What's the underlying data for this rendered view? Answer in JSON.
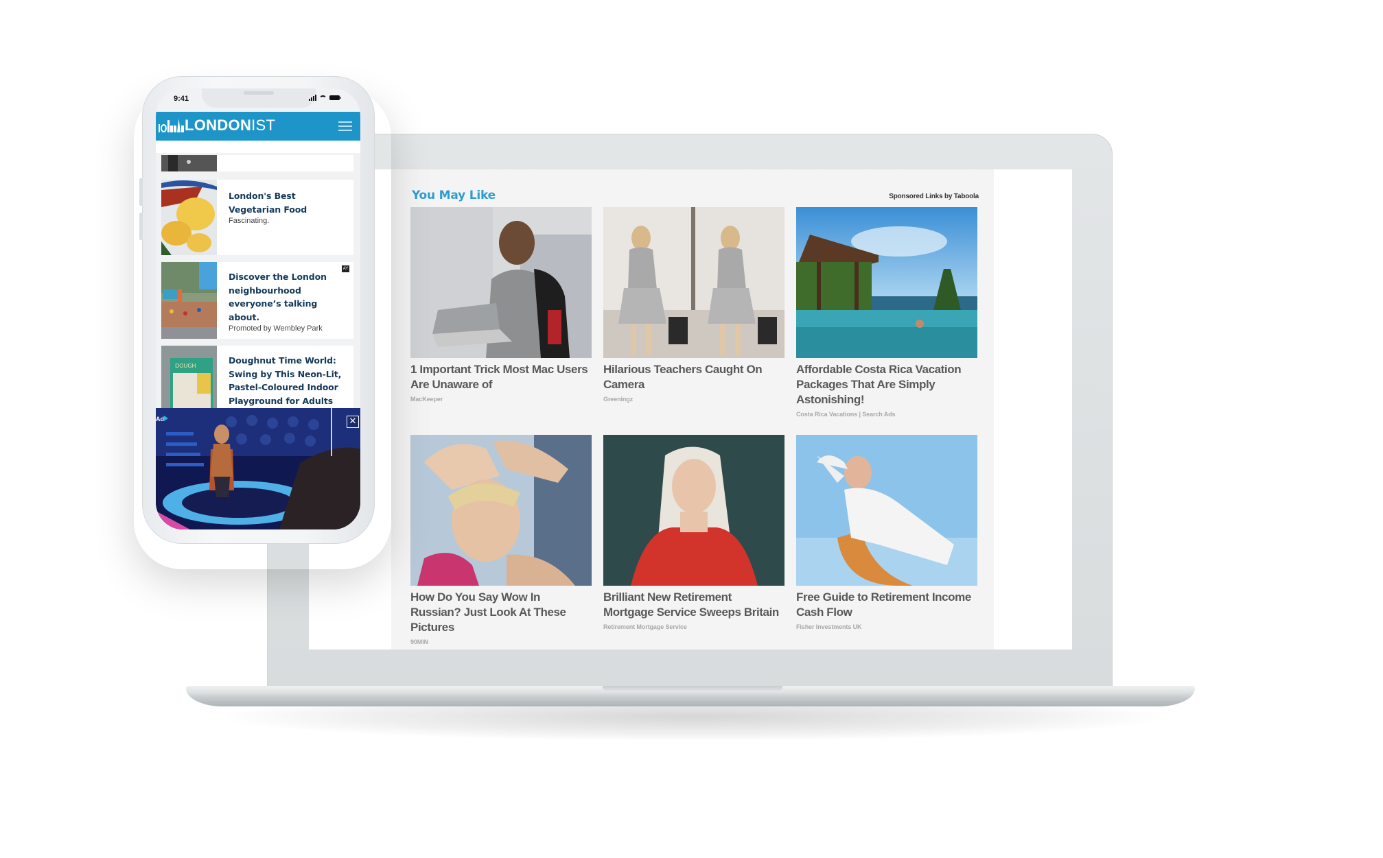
{
  "phone": {
    "status_time": "9:41",
    "status_icons": [
      "signal-icon",
      "wifi-icon",
      "battery-icon"
    ],
    "app": {
      "logo_bold": "LONDON",
      "logo_light": "IST",
      "header_color": "#1e95c9",
      "menu_icon": "hamburger-menu-icon"
    },
    "articles": [
      {
        "title": "",
        "subtitle": ""
      },
      {
        "title": "London's Best Vegetarian Food",
        "subtitle": "Fascinating."
      },
      {
        "title": "Discover the London neighbourhood everyone’s talking about.",
        "subtitle": "Promoted by Wembley Park",
        "badge": "AY"
      },
      {
        "title": "Doughnut Time World: Swing by This Neon-Lit, Pastel-Coloured Indoor Playground for Adults",
        "subtitle": ""
      }
    ],
    "video_ad": {
      "label": "Ad",
      "close_label": "✕"
    }
  },
  "laptop": {
    "widget": {
      "title": "You May Like",
      "title_color": "#2b9ed0",
      "sponsor_label": "Sponsored Links by Taboola",
      "cards": [
        {
          "headline": "1 Important Trick Most Mac Users Are Unaware of",
          "source": "MacKeeper"
        },
        {
          "headline": "Hilarious Teachers Caught On Camera",
          "source": "Greeningz"
        },
        {
          "headline": "Affordable Costa Rica Vacation Packages That Are Simply Astonishing!",
          "source": "Costa Rica Vacations | Search Ads"
        },
        {
          "headline": "How Do You Say Wow In Russian? Just Look At These Pictures",
          "source": "90MIN"
        },
        {
          "headline": "Brilliant New Retirement Mortgage Service Sweeps Britain",
          "source": "Retirement Mortgage Service"
        },
        {
          "headline": "Free Guide to Retirement Income Cash Flow",
          "source": "Fisher Investments UK"
        }
      ]
    }
  }
}
